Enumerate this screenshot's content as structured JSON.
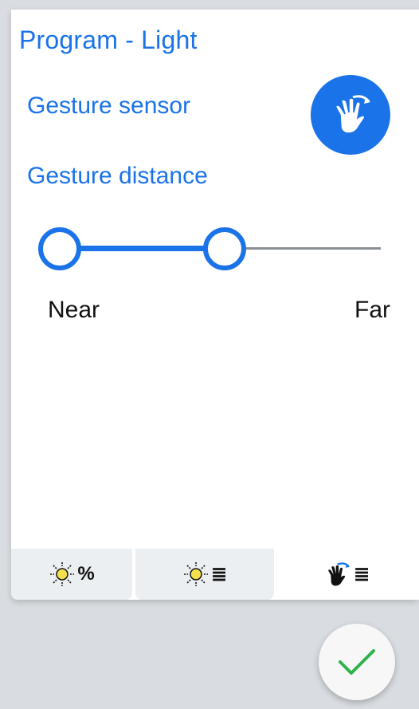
{
  "header": {
    "title": "Program - Light"
  },
  "gesture_sensor": {
    "label": "Gesture sensor",
    "icon": "hand-wave-icon",
    "color": "#1a73e8"
  },
  "gesture_distance": {
    "label": "Gesture distance",
    "min_label": "Near",
    "max_label": "Far",
    "range_start": 0.0,
    "range_end": 0.55
  },
  "tabs": [
    {
      "icon": "sun-icon",
      "text": "%",
      "active": false
    },
    {
      "icon": "sun-icon",
      "text": "≣",
      "active": false
    },
    {
      "icon": "hand-wave-icon",
      "text": "≣",
      "active": true
    }
  ],
  "confirm": {
    "icon": "checkmark-icon",
    "color": "#2fb34a"
  }
}
